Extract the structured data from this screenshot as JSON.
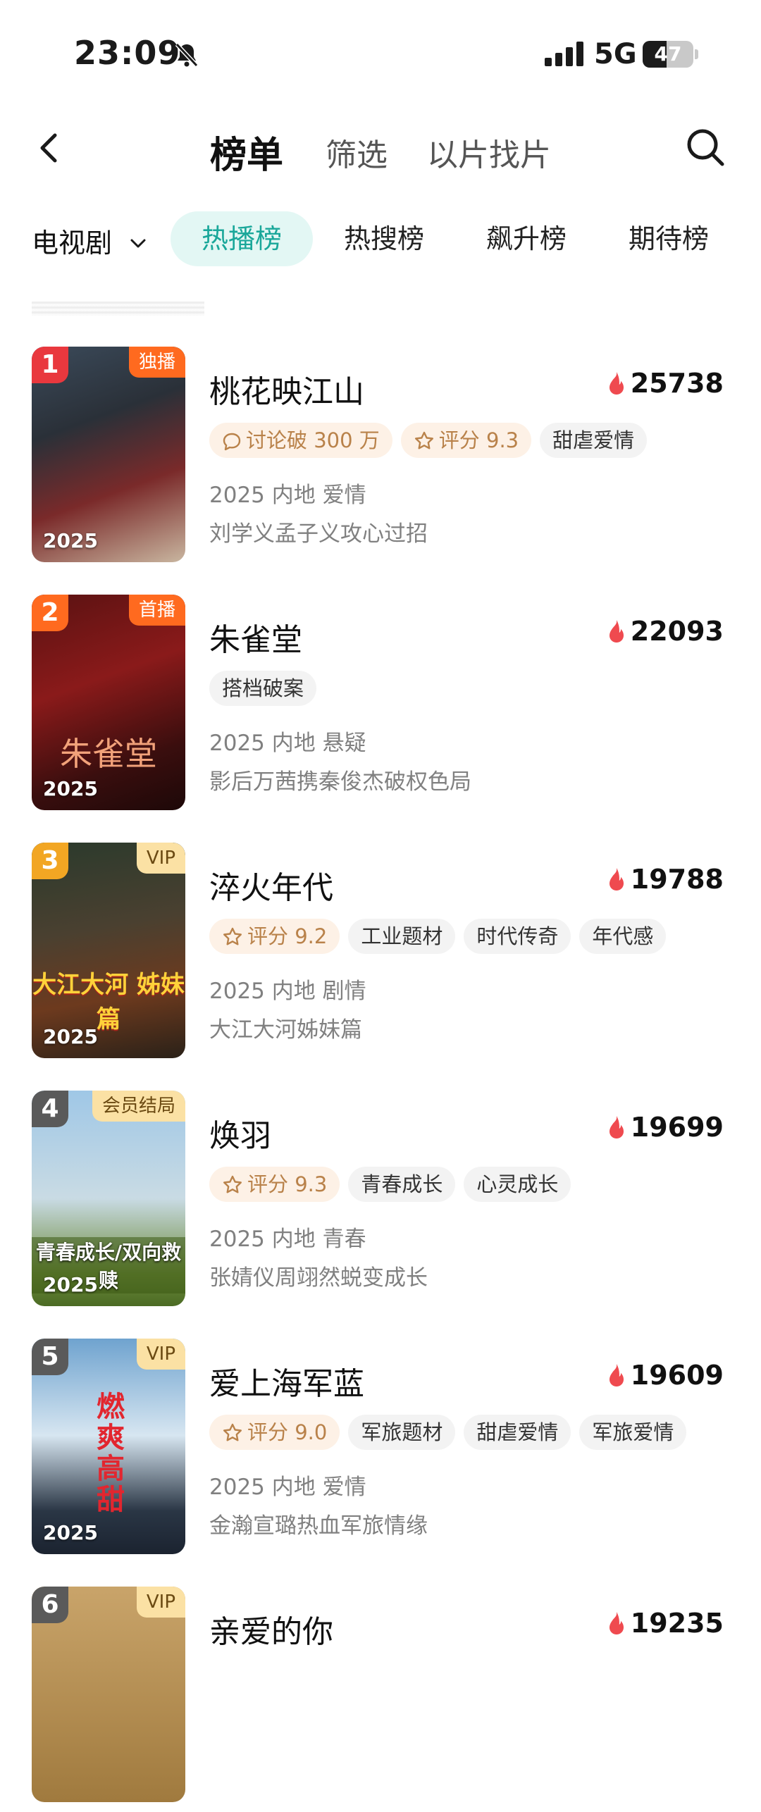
{
  "status": {
    "time": "23:09",
    "network": "5G",
    "battery": "47",
    "battery_level": 0.47
  },
  "nav": {
    "title": "榜单",
    "filter": "筛选",
    "find_by_clip": "以片找片"
  },
  "category": "电视剧",
  "tabs": [
    "热播榜",
    "热搜榜",
    "飙升榜",
    "期待榜"
  ],
  "items": [
    {
      "rank": "1",
      "badge": "独播",
      "year": "2025",
      "name": "桃花映江山",
      "heat": "25738",
      "tags": [
        {
          "text": "讨论破 300 万",
          "icon": "comment-icon",
          "hot": true
        },
        {
          "text": "评分 9.3",
          "icon": "star-icon",
          "hot": true
        },
        {
          "text": "甜虐爱情"
        }
      ],
      "meta": "2025 内地 爱情",
      "desc": "刘学义孟子义攻心过招",
      "colors": {
        "rank": "#e9383e",
        "badge_bg": "#ff6a1f",
        "badge_text": "#ffffff"
      }
    },
    {
      "rank": "2",
      "badge": "首播",
      "year": "2025",
      "name": "朱雀堂",
      "heat": "22093",
      "tags": [
        {
          "text": "搭档破案"
        }
      ],
      "meta": "2025 内地 悬疑",
      "desc": "影后万茜携秦俊杰破权色局",
      "caption": "朱雀堂",
      "colors": {
        "rank": "#ff6a1f",
        "badge_bg": "#ff6a1f",
        "badge_text": "#ffffff"
      }
    },
    {
      "rank": "3",
      "badge": "VIP",
      "year": "2025",
      "name": "淬火年代",
      "heat": "19788",
      "tags": [
        {
          "text": "评分 9.2",
          "icon": "star-icon",
          "hot": true
        },
        {
          "text": "工业题材"
        },
        {
          "text": "时代传奇"
        },
        {
          "text": "年代感"
        }
      ],
      "meta": "2025 内地 剧情",
      "desc": "大江大河姊妹篇",
      "caption": "大江大河 姊妹篇",
      "colors": {
        "rank": "#f2a623",
        "badge_bg": "#fbe1a4",
        "badge_text": "#6b4a12"
      }
    },
    {
      "rank": "4",
      "badge": "会员结局",
      "year": "2025",
      "name": "焕羽",
      "heat": "19699",
      "tags": [
        {
          "text": "评分 9.3",
          "icon": "star-icon",
          "hot": true
        },
        {
          "text": "青春成长"
        },
        {
          "text": "心灵成长"
        }
      ],
      "meta": "2025 内地 青春",
      "desc": "张婧仪周翊然蜕变成长",
      "caption": "青春成长/双向救赎",
      "colors": {
        "rank": "#5a5a5a",
        "badge_bg": "#fbe1a4",
        "badge_text": "#6b4a12"
      }
    },
    {
      "rank": "5",
      "badge": "VIP",
      "year": "2025",
      "name": "爱上海军蓝",
      "heat": "19609",
      "tags": [
        {
          "text": "评分 9.0",
          "icon": "star-icon",
          "hot": true
        },
        {
          "text": "军旅题材"
        },
        {
          "text": "甜虐爱情"
        },
        {
          "text": "军旅爱情"
        }
      ],
      "meta": "2025 内地 爱情",
      "desc": "金瀚宣璐热血军旅情缘",
      "caption": "燃爽高甜",
      "colors": {
        "rank": "#5a5a5a",
        "badge_bg": "#fbe1a4",
        "badge_text": "#6b4a12"
      }
    },
    {
      "rank": "6",
      "badge": "VIP",
      "year": "",
      "name": "亲爱的你",
      "heat": "19235",
      "tags": [],
      "meta": "",
      "desc": "",
      "colors": {
        "rank": "#5a5a5a",
        "badge_bg": "#fbe1a4",
        "badge_text": "#6b4a12"
      }
    }
  ],
  "colors": {
    "accent": "#1aa79a",
    "accent_bg": "#e3f7f4",
    "flame": "#ef4a4f",
    "tag_hot_text": "#b9824a"
  }
}
